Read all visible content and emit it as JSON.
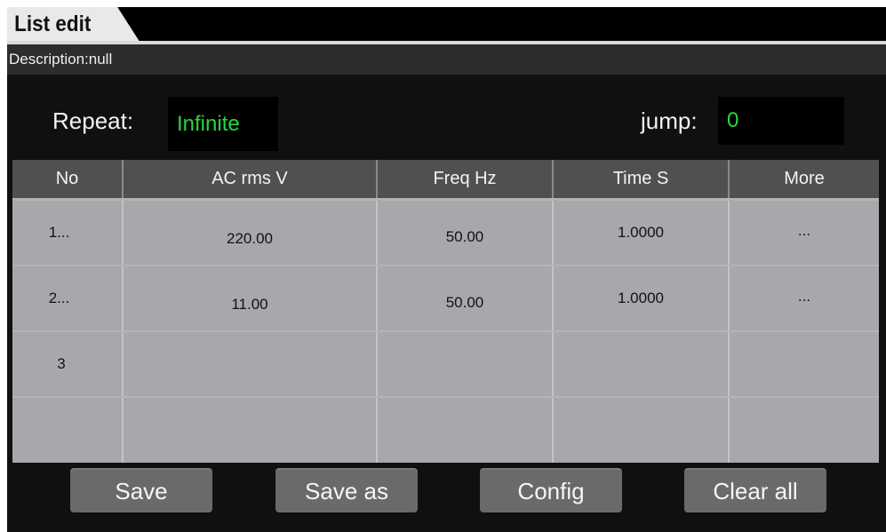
{
  "window": {
    "tab_title": "List edit"
  },
  "description": "Description:null",
  "repeat": {
    "label": "Repeat:",
    "value": "Infinite"
  },
  "jump": {
    "label": "jump:",
    "value": "0"
  },
  "table": {
    "headers": [
      "No",
      "AC rms V",
      "Freq Hz",
      "Time S",
      "More"
    ],
    "rows": [
      {
        "no": "1...",
        "ac": "220.00",
        "freq": "50.00",
        "time": "1.0000",
        "more": "..."
      },
      {
        "no": "2...",
        "ac": "11.00",
        "freq": "50.00",
        "time": "1.0000",
        "more": "..."
      },
      {
        "no": "3",
        "ac": "",
        "freq": "",
        "time": "",
        "more": ""
      },
      {
        "no": "",
        "ac": "",
        "freq": "",
        "time": "",
        "more": ""
      }
    ]
  },
  "buttons": {
    "save": "Save",
    "save_as": "Save as",
    "config": "Config",
    "clear_all": "Clear all"
  },
  "colors": {
    "value_green": "#27d83a",
    "header_bg": "#505050",
    "cell_bg": "#a8a7ab",
    "button_bg": "#6a6a6a"
  }
}
